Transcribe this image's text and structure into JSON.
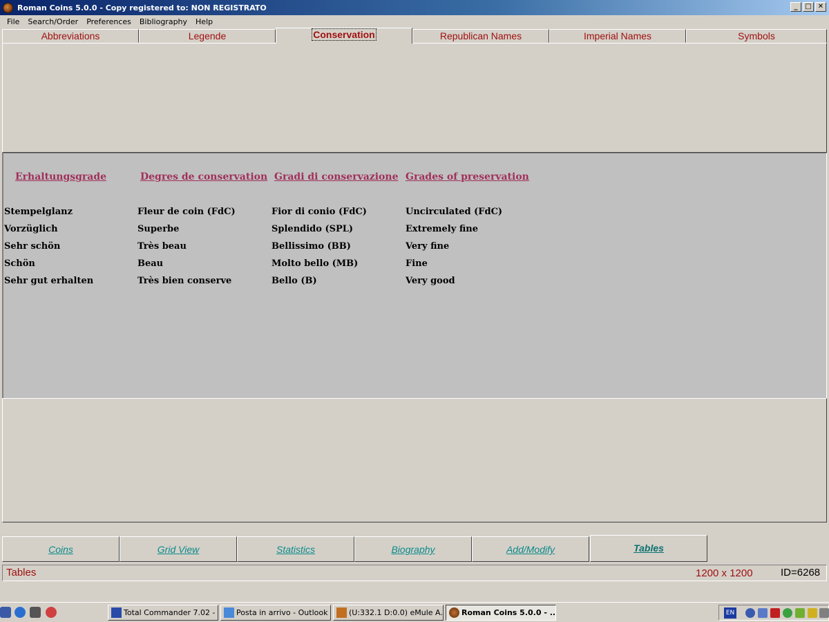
{
  "window": {
    "title": "Roman Coins 5.0.0 - Copy registered to:  NON REGISTRATO",
    "buttons": [
      "_",
      "□",
      "✕"
    ]
  },
  "menu": [
    "File",
    "Search/Order",
    "Preferences",
    "Bibliography",
    "Help"
  ],
  "tabs": {
    "items": [
      "Abbreviations",
      "Legende",
      "Conservation",
      "Republican Names",
      "Imperial Names",
      "Symbols"
    ],
    "active": "Conservation"
  },
  "table": {
    "headers": [
      "Erhaltungsgrade",
      "Degres de conservation",
      "Gradi di conservazione",
      "Grades of preservation"
    ],
    "rows": [
      [
        "Stempelglanz",
        "Fleur de coin (FdC)",
        "Fior di conio (FdC)",
        "Uncirculated (FdC)"
      ],
      [
        "Vorzüglich",
        "Superbe",
        "Splendido (SPL)",
        "Extremely fine"
      ],
      [
        "Sehr schön",
        "Très beau",
        "Bellissimo (BB)",
        "Very fine"
      ],
      [
        "Schön",
        "Beau",
        "Molto bello (MB)",
        "Fine"
      ],
      [
        "Sehr gut erhalten",
        "Très bien conserve",
        "Bello (B)",
        "Very good"
      ]
    ]
  },
  "bottom_tabs": {
    "items": [
      "Coins",
      "Grid View",
      "Statistics",
      "Biography",
      "Add/Modify",
      "Tables"
    ],
    "active": "Tables"
  },
  "status": {
    "left": "Tables",
    "size": "1200 x 1200",
    "id": "ID=6268"
  },
  "taskbar": {
    "buttons": [
      "Total Commander 7.02 - ...",
      "Posta in arrivo - Outlook ...",
      "(U:332.1 D:0.0) eMule A...",
      "Roman Coins 5.0.0 - ..."
    ],
    "active": "Roman Coins 5.0.0 - ...",
    "language": "EN"
  },
  "colors": {
    "tab_text": "#a01010",
    "header_text": "#a0305a",
    "bottom_tab_text": "#0a8a8a",
    "title_bar": "#0a246a"
  }
}
